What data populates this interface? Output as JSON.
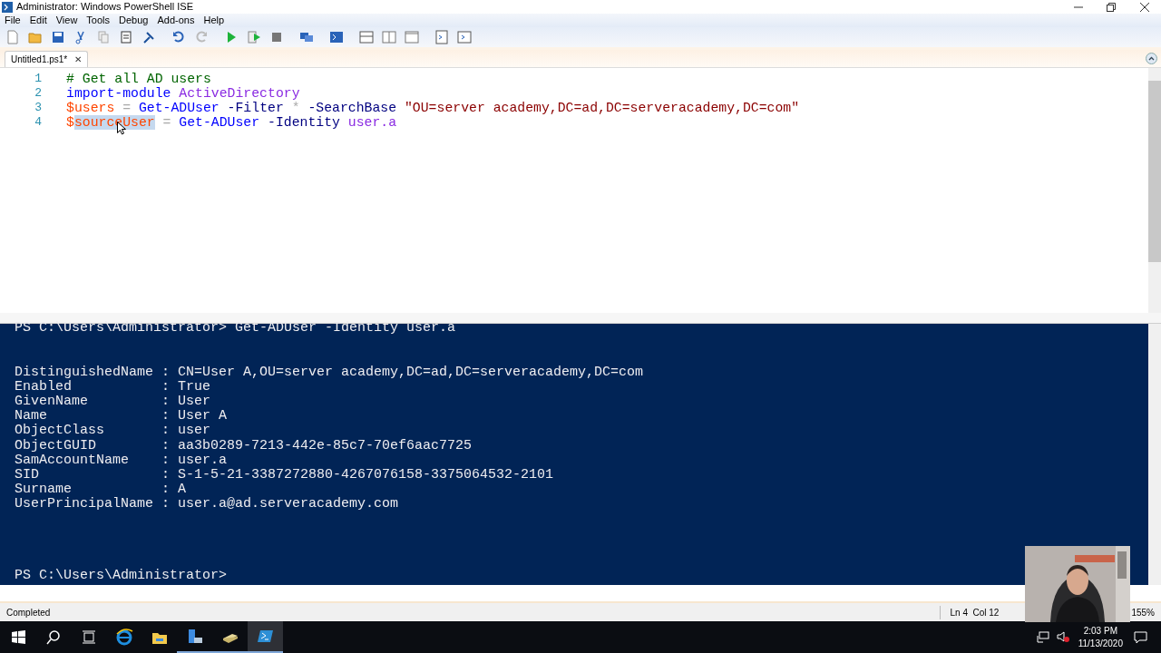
{
  "window": {
    "title": "Administrator: Windows PowerShell ISE"
  },
  "menu": [
    "File",
    "Edit",
    "View",
    "Tools",
    "Debug",
    "Add-ons",
    "Help"
  ],
  "tabs": [
    {
      "label": "Untitled1.ps1*",
      "selected": true,
      "close": "✕"
    }
  ],
  "editor": {
    "lines": [
      {
        "number": "1",
        "tokens": [
          {
            "kind": "comment",
            "text": "# Get all AD users"
          }
        ]
      },
      {
        "number": "2",
        "tokens": [
          {
            "kind": "command",
            "text": "import-module "
          },
          {
            "kind": "argument",
            "text": "ActiveDirectory"
          }
        ]
      },
      {
        "number": "3",
        "tokens": [
          {
            "kind": "variable",
            "text": "$users"
          },
          {
            "kind": "operator",
            "text": " = "
          },
          {
            "kind": "command",
            "text": "Get-ADUser "
          },
          {
            "kind": "parameter",
            "text": "-Filter "
          },
          {
            "kind": "operator",
            "text": "* "
          },
          {
            "kind": "parameter",
            "text": "-SearchBase "
          },
          {
            "kind": "string",
            "text": "\"OU=server academy,DC=ad,DC=serveracademy,DC=com\""
          }
        ]
      },
      {
        "number": "4",
        "tokens": [
          {
            "kind": "variable",
            "text": "$"
          },
          {
            "kind": "variable",
            "text": "sourceUser",
            "selected": true
          },
          {
            "kind": "operator",
            "text": " = "
          },
          {
            "kind": "command",
            "text": "Get-ADUser "
          },
          {
            "kind": "parameter",
            "text": "-Identity "
          },
          {
            "kind": "argument",
            "text": "user.a"
          }
        ]
      }
    ]
  },
  "console": {
    "command": "PS C:\\Users\\Administrator> Get-ADUser -Identity user.a",
    "output": [
      "DistinguishedName : CN=User A,OU=server academy,DC=ad,DC=serveracademy,DC=com",
      "Enabled           : True",
      "GivenName         : User",
      "Name              : User A",
      "ObjectClass       : user",
      "ObjectGUID        : aa3b0289-7213-442e-85c7-70ef6aac7725",
      "SamAccountName    : user.a",
      "SID               : S-1-5-21-3387272880-4267076158-3375064532-2101",
      "Surname           : A",
      "UserPrincipalName : user.a@ad.serveracademy.com"
    ],
    "prompt": "PS C:\\Users\\Administrator>"
  },
  "status_bar": {
    "status": "Completed",
    "position": "Ln 4  Col 12",
    "zoom": "155%"
  },
  "taskbar": {
    "time": "2:03 PM",
    "date": "11/13/2020"
  }
}
